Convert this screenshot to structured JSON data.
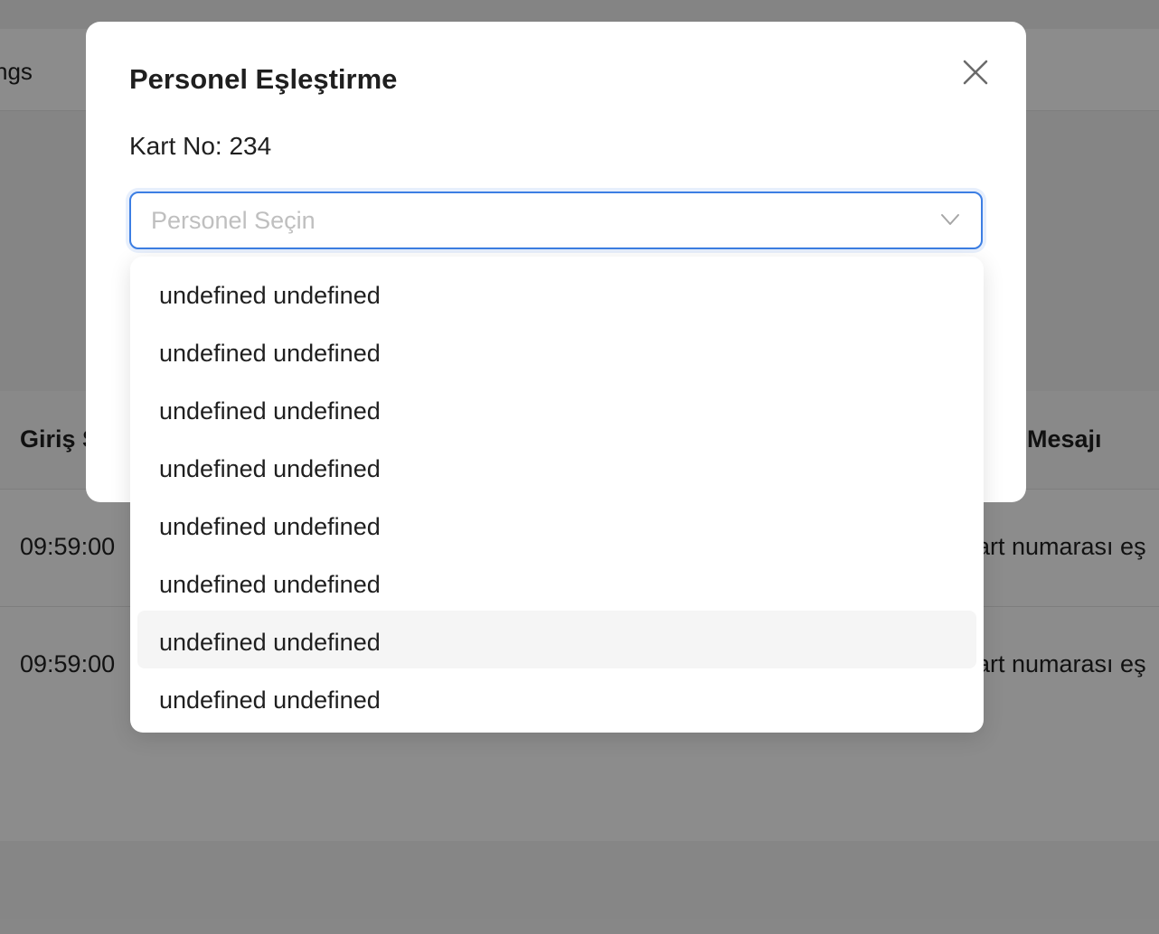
{
  "background": {
    "header_fragment": "ngs",
    "table": {
      "headers": [
        "Giriş S",
        "Mesajı"
      ],
      "rows": [
        {
          "time": "09:59:00",
          "message": "art numarası eş"
        },
        {
          "time": "09:59:00",
          "message": "art numarası eş"
        }
      ]
    }
  },
  "modal": {
    "title": "Personel Eşleştirme",
    "close_icon": "close-icon",
    "kart_label": "Kart No: 234",
    "select": {
      "placeholder": "Personel Seçin",
      "icon": "chevron-down-icon"
    },
    "options": [
      {
        "label": "undefined undefined"
      },
      {
        "label": "undefined undefined"
      },
      {
        "label": "undefined undefined"
      },
      {
        "label": "undefined undefined"
      },
      {
        "label": "undefined undefined"
      },
      {
        "label": "undefined undefined"
      },
      {
        "label": "undefined undefined",
        "highlighted": true
      },
      {
        "label": "undefined undefined"
      }
    ]
  },
  "colors": {
    "accent": "#3c7ee3",
    "overlay": "rgba(0,0,0,0.45)",
    "option_hover": "#f5f5f5"
  }
}
